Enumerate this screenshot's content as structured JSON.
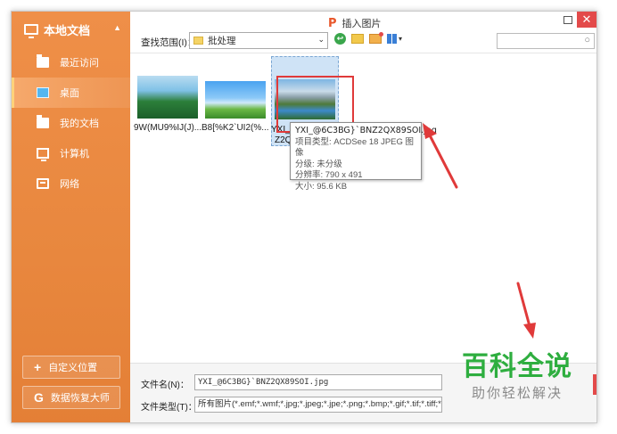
{
  "dialog": {
    "title": "插入图片",
    "close_glyph": "✕",
    "title_logo": "P"
  },
  "sidebar": {
    "header": "本地文档",
    "items": [
      {
        "label": "最近访问",
        "icon": "folder-clock-icon"
      },
      {
        "label": "桌面",
        "icon": "desktop-icon",
        "active": true
      },
      {
        "label": "我的文档",
        "icon": "folder-icon"
      },
      {
        "label": "计算机",
        "icon": "computer-icon"
      },
      {
        "label": "网络",
        "icon": "network-icon"
      }
    ],
    "buttons": [
      {
        "label": "自定义位置",
        "glyph": "+"
      },
      {
        "label": "数据恢复大师",
        "glyph": "G"
      }
    ]
  },
  "toolbar": {
    "lookin_label": "查找范围(I)：",
    "lookin_value": "批处理",
    "dropdown_glyph": "⌄",
    "back_glyph": "↩",
    "search_glyph": "○",
    "view_glyph": "▾"
  },
  "files": [
    {
      "name": "9W(MU9%IJ(J)..."
    },
    {
      "name": "B8[%K2`UI2(%..."
    },
    {
      "name": "YXI_@6C3BG]`BNZ2QX89SOI.jpg",
      "name_line1": "YXI_(",
      "name_line2": "Z2Q"
    }
  ],
  "tooltip": {
    "filename": "YXI_@6C3BG}`BNZ2QX89SOI.jpg",
    "type": "项目类型: ACDSee 18 JPEG 图像",
    "rating": "分级: 未分级",
    "resolution": "分辨率: 790 x 491",
    "size": "大小: 95.6 KB"
  },
  "bottom": {
    "filename_label": "文件名(N)：",
    "filename_value": "YXI_@6C3BG}`BNZ2QX89SOI.jpg",
    "filetype_label": "文件类型(T)：",
    "filetype_value": "所有图片(*.emf;*.wmf;*.jpg;*.jpeg;*.jpe;*.png;*.bmp;*.gif;*.tif;*.tiff;*.wdp"
  },
  "watermark": {
    "big": "百科全说",
    "small": "助你轻松解决"
  },
  "colors": {
    "sidebar": "#e8873e",
    "accent_red": "#e03a3a",
    "close": "#e34a4a",
    "watermark_green": "#2eae3f"
  }
}
